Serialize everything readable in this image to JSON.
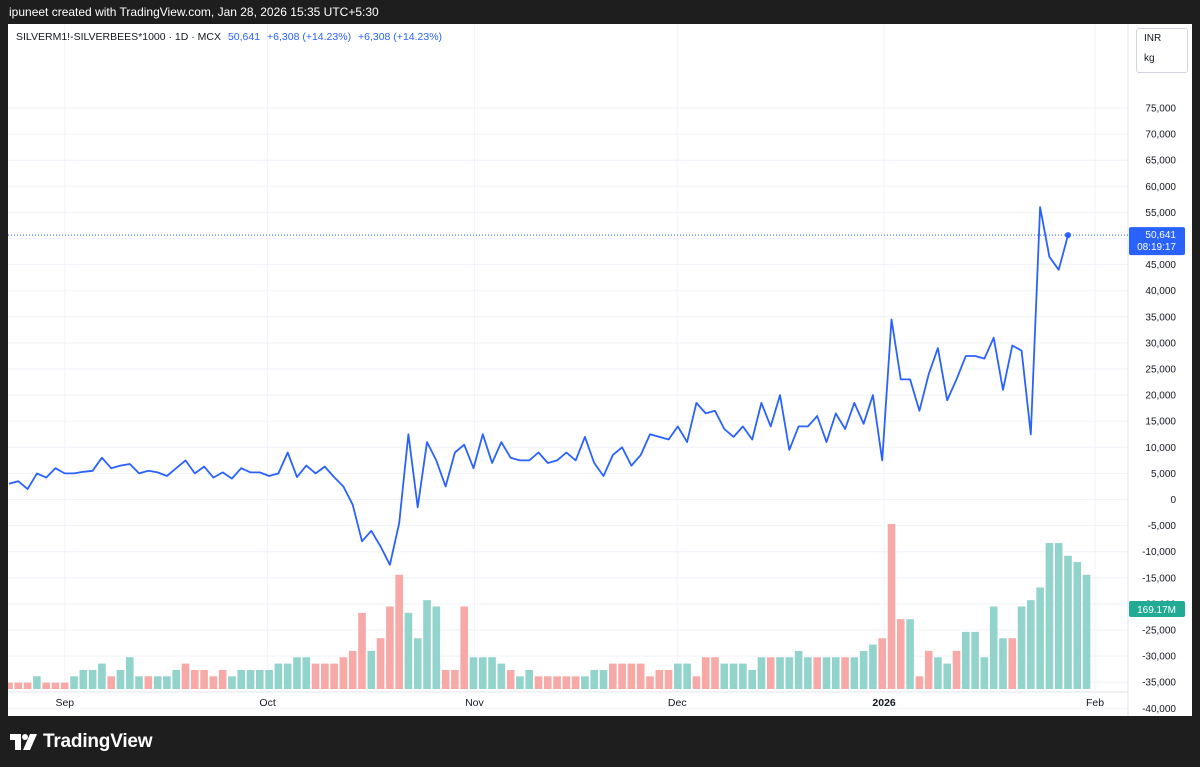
{
  "header": {
    "text": "ipuneet created with TradingView.com, Jan 28, 2026 15:35 UTC+5:30"
  },
  "legend": {
    "symbol": "SILVERM1!-SILVERBEES*1000 · 1D · MCX",
    "last": "50,641",
    "change1": "+6,308 (+14.23%)",
    "change2": "+6,308 (+14.23%)"
  },
  "unit_box": {
    "currency": "INR",
    "unit": "kg"
  },
  "price_label": {
    "value": "50,641",
    "countdown": "08:19:17"
  },
  "volume_label": "169.17M",
  "footer": {
    "brand": "TradingView"
  },
  "colors": {
    "line": "#2962ff",
    "vol_up": "#92d3cc",
    "vol_down": "#f7a9a7",
    "vol_label": "#22ab94",
    "price_label": "#2962ff"
  },
  "chart_data": {
    "type": "line",
    "y_ticks": [
      "75,000",
      "70,000",
      "65,000",
      "60,000",
      "55,000",
      "50,000",
      "45,000",
      "40,000",
      "35,000",
      "30,000",
      "25,000",
      "20,000",
      "15,000",
      "10,000",
      "5,000",
      "0",
      "-5,000",
      "-10,000",
      "-15,000",
      "-20,000",
      "-25,000",
      "-30,000",
      "-35,000",
      "-40,000"
    ],
    "ylim": [
      -40000,
      75000
    ],
    "x_ticks": [
      "Sep",
      "Oct",
      "Nov",
      "Dec",
      "2026",
      "Feb"
    ],
    "x_tick_positions": [
      14,
      64,
      115,
      165,
      216,
      268
    ],
    "last_value": 50641,
    "series": [
      {
        "values": [
          3000,
          3500,
          2000,
          5000,
          4200,
          6000,
          5000,
          5000,
          5300,
          5500,
          8000,
          6000,
          6500,
          6800,
          5000,
          5500,
          5200,
          4500,
          6000,
          7500,
          5000,
          6300,
          4200,
          5200,
          4000,
          6000,
          5200,
          5200,
          4500,
          5000,
          9000,
          4300,
          6500,
          5000,
          6300,
          4300,
          2500,
          -1000,
          -8000,
          -6000,
          -9000,
          -12500,
          -4500,
          12500,
          -1500,
          11000,
          7500,
          2500,
          9000,
          10500,
          6000,
          12500,
          7000,
          11000,
          8000,
          7500,
          7500,
          9000,
          7000,
          7500,
          9000,
          7500,
          12000,
          7000,
          4500,
          8500,
          10000,
          6500,
          8500,
          12500,
          12000,
          11500,
          14000,
          11000,
          18500,
          16500,
          17000,
          13500,
          12000,
          14000,
          11500,
          18500,
          14000,
          20000,
          9500,
          14000,
          14000,
          16000,
          11000,
          16500,
          13500,
          18500,
          14500,
          20000,
          7500,
          34500,
          23000,
          23000,
          17000,
          24000,
          29000,
          19000,
          23000,
          27500,
          27500,
          27000,
          31000,
          21000,
          29500,
          28500,
          12500,
          56000,
          46500,
          44000,
          50641
        ]
      }
    ],
    "volume": {
      "up": [
        false,
        false,
        false,
        true,
        false,
        false,
        false,
        true,
        true,
        true,
        true,
        false,
        true,
        true,
        true,
        false,
        true,
        true,
        true,
        false,
        false,
        false,
        false,
        false,
        true,
        true,
        true,
        true,
        true,
        true,
        true,
        true,
        true,
        false,
        false,
        false,
        false,
        false,
        false,
        true,
        false,
        false,
        false,
        true,
        true,
        true,
        true,
        false,
        false,
        false,
        true,
        true,
        true,
        true,
        false,
        true,
        true,
        false,
        false,
        false,
        false,
        false,
        true,
        true,
        true,
        false,
        false,
        false,
        false,
        false,
        false,
        false,
        true,
        true,
        false,
        false,
        false,
        true,
        true,
        true,
        true,
        true,
        false,
        true,
        true,
        true,
        true,
        false,
        true,
        true,
        false,
        true,
        true,
        true,
        false,
        false,
        false,
        true,
        false,
        false,
        true,
        true,
        false,
        true,
        true,
        true,
        true,
        true,
        false,
        true,
        true,
        true,
        true,
        true,
        true,
        true,
        true
      ],
      "values": [
        1,
        1,
        1,
        2,
        1,
        1,
        1,
        2,
        3,
        3,
        4,
        2,
        3,
        5,
        2,
        2,
        2,
        2,
        3,
        4,
        3,
        3,
        2,
        3,
        2,
        3,
        3,
        3,
        3,
        4,
        4,
        5,
        5,
        4,
        4,
        4,
        5,
        6,
        12,
        6,
        8,
        13,
        18,
        12,
        8,
        14,
        13,
        3,
        3,
        13,
        5,
        5,
        5,
        4,
        3,
        2,
        3,
        2,
        2,
        2,
        2,
        2,
        2,
        3,
        3,
        4,
        4,
        4,
        4,
        2,
        3,
        3,
        4,
        4,
        2,
        5,
        5,
        4,
        4,
        4,
        3,
        5,
        5,
        5,
        5,
        6,
        5,
        5,
        5,
        5,
        5,
        5,
        6,
        7,
        8,
        26,
        11,
        11,
        2,
        6,
        5,
        4,
        6,
        9,
        9,
        5,
        13,
        8,
        8,
        13,
        14,
        16,
        23,
        23,
        21,
        20,
        18
      ]
    }
  }
}
